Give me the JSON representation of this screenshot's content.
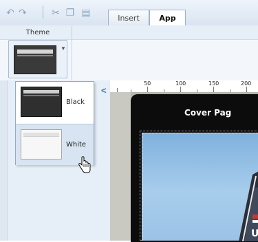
{
  "toolbar": {
    "icons": [
      "undo-icon",
      "redo-icon",
      "cut-icon",
      "copy-icon",
      "paste-icon"
    ],
    "tabs": [
      {
        "label": "Insert",
        "active": false
      },
      {
        "label": "App",
        "active": true
      }
    ]
  },
  "ribbon": {
    "group_label": "Theme",
    "theme_button_selected": "Black"
  },
  "theme_dropdown": {
    "items": [
      {
        "label": "Black",
        "icon": "black-theme-thumbnail"
      },
      {
        "label": "White",
        "icon": "white-theme-thumbnail",
        "hovered": true
      }
    ]
  },
  "ruler": {
    "labels": [
      "50",
      "100",
      "150",
      "200"
    ]
  },
  "page": {
    "title": "Cover Pag"
  },
  "colors": {
    "accent": "#3a78c4",
    "ribbon": "#f3f7fc",
    "page_frame": "#0c0c0c",
    "hover": "#d8e4f1"
  }
}
